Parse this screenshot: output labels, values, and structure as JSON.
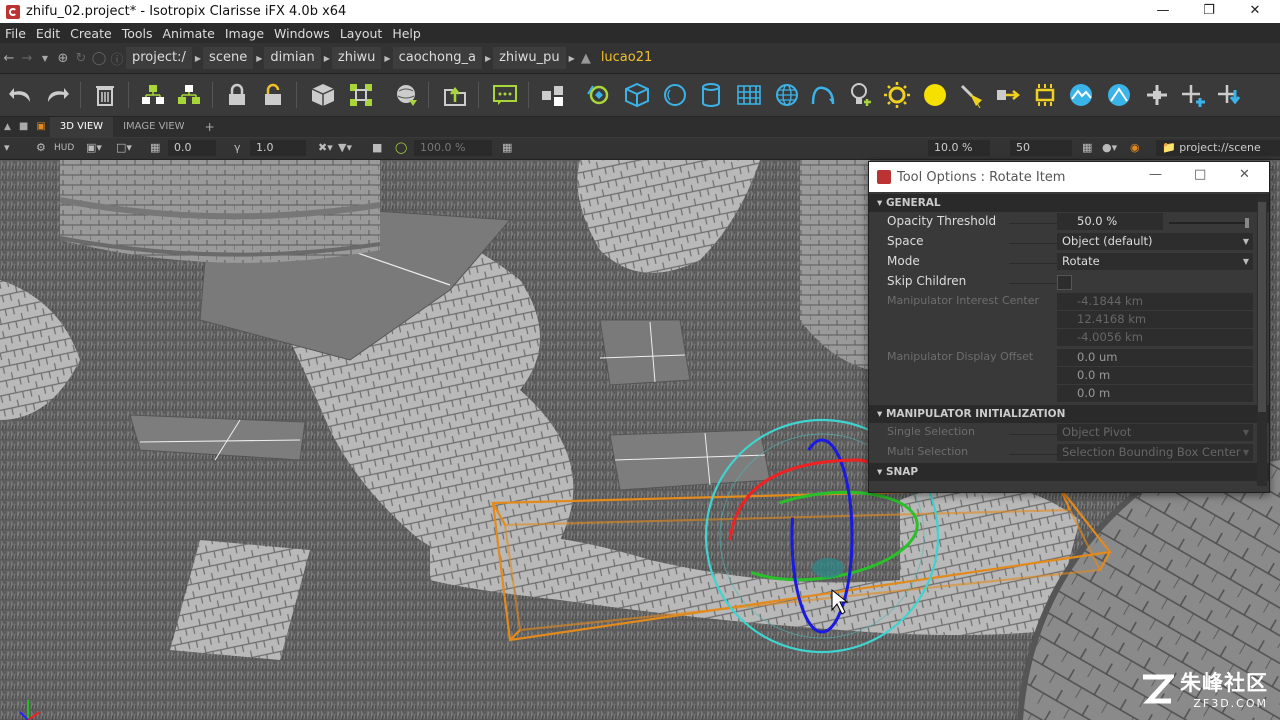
{
  "window": {
    "title": "zhifu_02.project* - Isotropix Clarisse iFX 4.0b x64"
  },
  "menu": [
    "File",
    "Edit",
    "Create",
    "Tools",
    "Animate",
    "Image",
    "Windows",
    "Layout",
    "Help"
  ],
  "breadcrumb": [
    "project:/",
    "scene",
    "dimian",
    "zhiwu",
    "caochong_a",
    "zhiwu_pu",
    "lucao21"
  ],
  "tabs": {
    "view3d": "3D VIEW",
    "image_view": "IMAGE VIEW",
    "add": "+"
  },
  "viewbar": {
    "hud": "HUD",
    "value1": "0.0",
    "gamma": "1.0",
    "percent": "100.0 %",
    "zoom": "10.0 %",
    "samples": "50",
    "context": "project://scene"
  },
  "tool_options": {
    "title": "Tool Options : Rotate Item",
    "general": {
      "header": "GENERAL",
      "opacity_label": "Opacity Threshold",
      "opacity_value": "50.0 %",
      "opacity_level": 0.5,
      "space_label": "Space",
      "space_value": "Object (default)",
      "mode_label": "Mode",
      "mode_value": "Rotate",
      "skip_label": "Skip Children",
      "interest_label": "Manipulator Interest Center",
      "interest": [
        "-4.1844 km",
        "12.4168 km",
        "-4.0056 km"
      ],
      "offset_label": "Manipulator Display Offset",
      "offset": [
        "0.0 um",
        "0.0 m",
        "0.0 m"
      ]
    },
    "manip": {
      "header": "MANIPULATOR INITIALIZATION",
      "single_label": "Single Selection",
      "single_value": "Object Pivot",
      "multi_label": "Multi Selection",
      "multi_value": "Selection Bounding Box Center"
    },
    "snap": {
      "header": "SNAP"
    }
  },
  "watermark": {
    "cn": "朱峰社区",
    "url": "ZF3D.COM"
  },
  "colors": {
    "accent_yellow": "#f0c02a",
    "tool_green": "#a8d63a",
    "tool_blue": "#3ab3e8",
    "orange_bbox": "#e38a1c"
  }
}
